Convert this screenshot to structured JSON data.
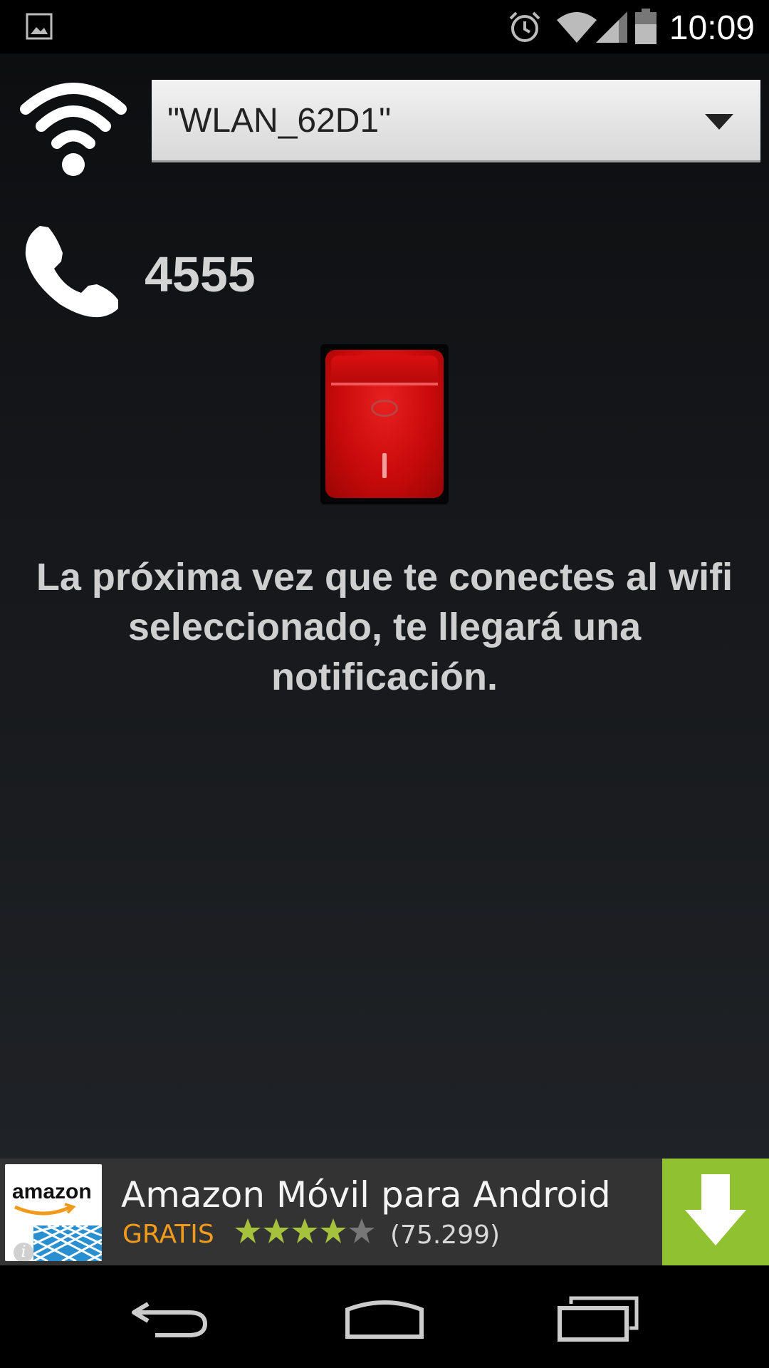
{
  "status_bar": {
    "time": "10:09",
    "icons": [
      "image-notification-icon",
      "alarm-icon",
      "wifi-signal-icon",
      "cell-signal-icon",
      "battery-icon"
    ]
  },
  "network": {
    "icon": "wifi-icon",
    "selected_ssid": "\"WLAN_62D1\""
  },
  "phone": {
    "icon": "phone-icon",
    "number": "4555"
  },
  "toggle": {
    "state": "off",
    "color": "#d10b0b"
  },
  "message": "La próxima vez que te conectes al wifi seleccionado, te llegará una notificación.",
  "ad": {
    "logo_text": "amazon",
    "title": "Amazon Móvil para Android",
    "price": "GRATIS",
    "rating": 4.0,
    "rating_max": 5,
    "reviews": "(75.299)",
    "download_color": "#8fc131",
    "price_color": "#f19b1c"
  },
  "nav_bar": {
    "buttons": [
      "back-icon",
      "home-icon",
      "recents-icon"
    ]
  }
}
